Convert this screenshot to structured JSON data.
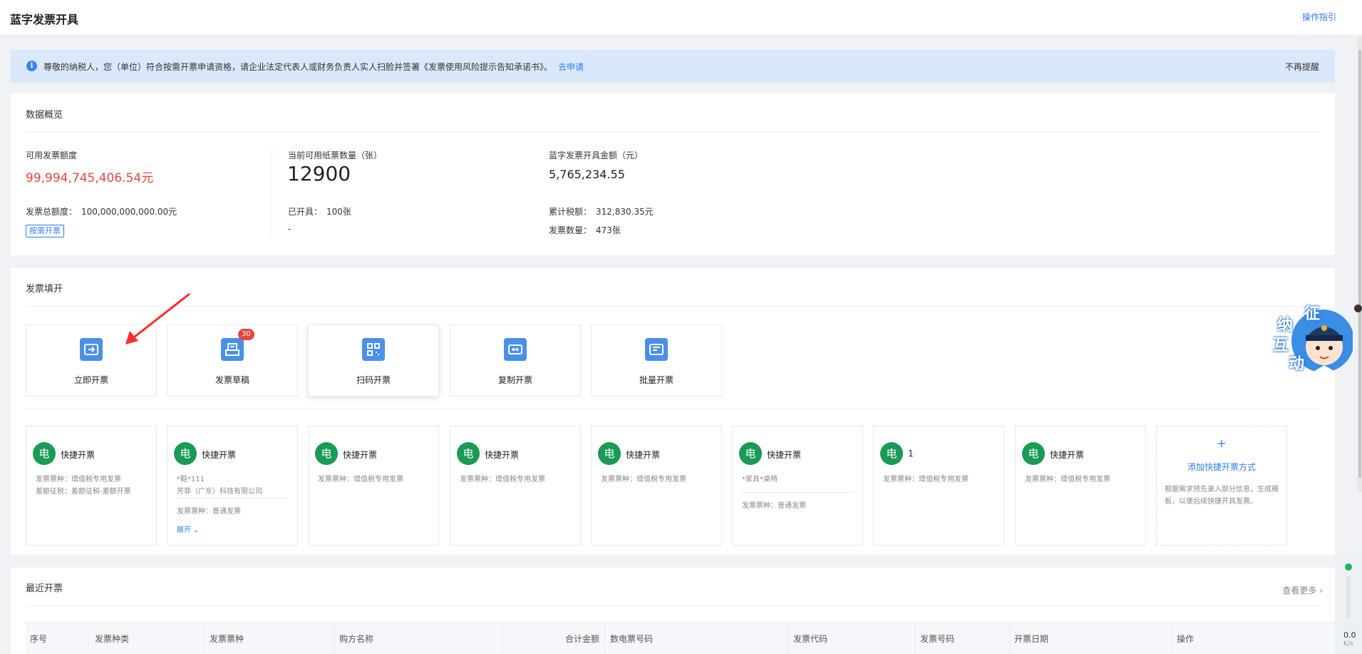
{
  "header": {
    "title": "蓝字发票开具",
    "guide": "操作指引"
  },
  "notice": {
    "text": "尊敬的纳税人，您（单位）符合按需开票申请资格，请企业法定代表人或财务负责人实人扫脸并签署《发票使用风险提示告知承诺书》。",
    "apply": "去申请",
    "dismiss": "不再提醒"
  },
  "overview": {
    "title": "数据概览",
    "quota_label": "可用发票额度",
    "quota_value": "99,994,745,406.54元",
    "total_label": "发票总额度：",
    "total_value": "100,000,000,000.00元",
    "on_demand_btn": "按需开票",
    "paper_label": "当前可用纸票数量（张）",
    "paper_value": "12900",
    "issued_label": "已开具：",
    "issued_value": "100张",
    "dash": "-",
    "amount_label": "蓝字发票开具金额（元）",
    "amount_value": "5,765,234.55",
    "tax_label": "累计税额：",
    "tax_value": "312,830.35元",
    "count_label": "发票数量：",
    "count_value": "473张"
  },
  "fill": {
    "title": "发票填开",
    "tiles": [
      {
        "label": "立即开票",
        "icon": "issue-now-icon"
      },
      {
        "label": "发票草稿",
        "icon": "draft-icon",
        "badge": "30"
      },
      {
        "label": "扫码开票",
        "icon": "qr-code-icon"
      },
      {
        "label": "复制开票",
        "icon": "copy-invoice-icon"
      },
      {
        "label": "批量开票",
        "icon": "batch-invoice-icon"
      }
    ],
    "quick_cards": [
      {
        "badge": "电",
        "title": "快捷开票",
        "line1": "发票票种：增值税专用发票",
        "line2": "差额征税：差额征税-差额开票"
      },
      {
        "badge": "电",
        "title": "快捷开票",
        "line1": "*鞋*111",
        "line2": "芳菲（广东）科技有限公司",
        "line3": "发票票种：普通发票",
        "expand": "展开"
      },
      {
        "badge": "电",
        "title": "快捷开票",
        "line1": "发票票种：增值税专用发票"
      },
      {
        "badge": "电",
        "title": "快捷开票",
        "line1": "发票票种：增值税专用发票"
      },
      {
        "badge": "电",
        "title": "快捷开票",
        "line1": "发票票种：增值税专用发票"
      },
      {
        "badge": "电",
        "title": "快捷开票",
        "line1": "*家具*桌椅",
        "line3": "发票票种：普通发票"
      },
      {
        "badge": "电",
        "title": "1",
        "line1": "发票票种：增值税专用发票"
      },
      {
        "badge": "电",
        "title": "快捷开票",
        "line1": "发票票种：增值税专用发票"
      }
    ],
    "add_quick": {
      "plus": "+",
      "title": "添加快捷开票方式",
      "desc": "根据需求预先录入部分信息，生成模板，以便后续快捷开具发票。"
    }
  },
  "recent": {
    "title": "最近开票",
    "more": "查看更多",
    "columns": [
      "序号",
      "发票种类",
      "发票票种",
      "购方名称",
      "合计金额",
      "数电票号码",
      "发票代码",
      "发票号码",
      "开票日期",
      "操作"
    ]
  },
  "assistant": {
    "chars": [
      "征",
      "纳",
      "互",
      "动"
    ]
  },
  "widget": {
    "value": "0.0",
    "unit": "K/s"
  },
  "colors": {
    "accent": "#2f7cf6",
    "danger": "#e5483b",
    "green": "#1a9a55",
    "notice_bg": "#d9e9fb"
  }
}
